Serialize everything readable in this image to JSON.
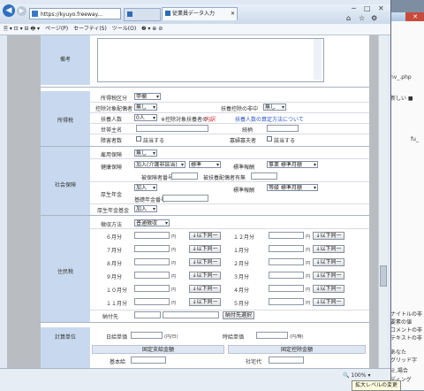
{
  "browser": {
    "url": "https://kyuyo.freeway...",
    "tab_inactive": "",
    "tab_active": "従業員データ入力",
    "window_controls": [
      "─",
      "□",
      "✕"
    ],
    "menu": [
      "ページ(P)",
      "セーフティ(S)",
      "ツール(O)"
    ],
    "zoom": "100%",
    "tooltip": "拡大レベルの変更"
  },
  "remarks": {
    "label": "備考"
  },
  "income_tax": {
    "section": "所得税",
    "r1": {
      "label": "所得税区分",
      "value": "甲欄"
    },
    "r2": {
      "label": "控除対象配偶者",
      "value": "無し",
      "label2": "扶養控除の非中",
      "value2": "無し"
    },
    "r3": {
      "label": "扶養人数",
      "value": "0人",
      "note": "※控除対象扶養者の",
      "link": "扶養人数の算定方法について"
    },
    "r4": {
      "label": "世帯主名",
      "label2": "続柄"
    },
    "r5": {
      "label": "障害者数",
      "check1": "該当する",
      "label2": "寡婦寡夫者",
      "check2": "該当する"
    }
  },
  "social": {
    "section": "社会保険",
    "r1": {
      "label": "雇用保険",
      "value": "無し"
    },
    "r2": {
      "label": "健康保険",
      "value": "加入(介護非該当)",
      "value_b": "標準",
      "label2": "標準報酬",
      "value2": "事業 標準月額"
    },
    "r3": {
      "label": "被保険者番号",
      "label2": "被扶養配偶者有無"
    },
    "r4": {
      "label": "厚生年金",
      "value": "加入",
      "label2": "標準報酬",
      "value2": "等級 標準月額"
    },
    "r5": {
      "label": "基礎年金番号"
    },
    "r6": {
      "label": "厚生年金基金",
      "value": "加入"
    }
  },
  "resident_tax": {
    "section": "住民税",
    "method_label": "徴収方法",
    "method_value": "普通徴収",
    "yen": "円",
    "copy_btn": "↓以下同一",
    "left_months": [
      "６月分",
      "７月分",
      "８月分",
      "９月分",
      "１０月分",
      "１１月分"
    ],
    "right_months": [
      "１２月分",
      "１月分",
      "２月分",
      "３月分",
      "４月分",
      "５月分"
    ],
    "payee_label": "納付先",
    "payee_btn": "納付先選択"
  },
  "calc": {
    "section": "計算単位",
    "daily_label": "日給単価",
    "daily_unit": "(円/日)",
    "hourly_label": "時給単価",
    "hourly_unit": "(円/時)",
    "hdr_left": "固定支給金額",
    "hdr_right": "固定控除金額",
    "basic_label": "基本給",
    "right_label": "社宅代"
  },
  "bg_window": {
    "lines": [
      "nv_.php",
      "新しい ■",
      "fu_",
      "ナイトルの非",
      "要素の値",
      "コメントの非",
      "テキストの非",
      "あなた",
      "グリッド字",
      "ミ,場合",
      "ディング"
    ]
  }
}
